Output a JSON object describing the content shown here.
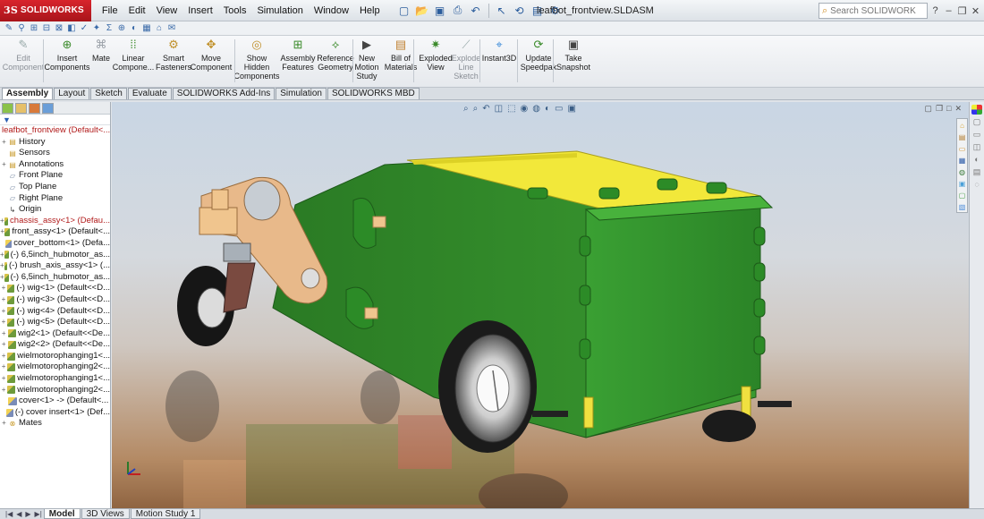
{
  "app": {
    "brand": "SOLIDWORKS",
    "document_title": "leafbot_frontview.SLDASM"
  },
  "menu": [
    "File",
    "Edit",
    "View",
    "Insert",
    "Tools",
    "Simulation",
    "Window",
    "Help"
  ],
  "search": {
    "placeholder": "Search SOLIDWORKS Help"
  },
  "commands": [
    {
      "label": "Edit Component",
      "icon": "edit-component-icon",
      "enabled": false
    },
    {
      "label": "Insert Components",
      "icon": "insert-components-icon",
      "enabled": true
    },
    {
      "label": "Mate",
      "icon": "mate-icon",
      "enabled": true
    },
    {
      "label": "Linear Compone...",
      "icon": "linear-pattern-icon",
      "enabled": true
    },
    {
      "label": "Smart Fasteners",
      "icon": "smart-fasteners-icon",
      "enabled": true
    },
    {
      "label": "Move Component",
      "icon": "move-component-icon",
      "enabled": true
    },
    {
      "label": "Show Hidden Components",
      "icon": "show-hidden-icon",
      "enabled": true
    },
    {
      "label": "Assembly Features",
      "icon": "assembly-features-icon",
      "enabled": true
    },
    {
      "label": "Reference Geometry",
      "icon": "reference-geometry-icon",
      "enabled": true
    },
    {
      "label": "New Motion Study",
      "icon": "motion-study-icon",
      "enabled": true
    },
    {
      "label": "Bill of Materials",
      "icon": "bom-icon",
      "enabled": true
    },
    {
      "label": "Exploded View",
      "icon": "exploded-view-icon",
      "enabled": true
    },
    {
      "label": "Explode Line Sketch",
      "icon": "explode-line-icon",
      "enabled": false
    },
    {
      "label": "Instant3D",
      "icon": "instant3d-icon",
      "enabled": true
    },
    {
      "label": "Update Speedpak",
      "icon": "speedpak-icon",
      "enabled": true
    },
    {
      "label": "Take Snapshot",
      "icon": "snapshot-icon",
      "enabled": true
    }
  ],
  "tabs": [
    "Assembly",
    "Layout",
    "Sketch",
    "Evaluate",
    "SOLIDWORKS Add-Ins",
    "Simulation",
    "SOLIDWORKS MBD"
  ],
  "active_tab": "Assembly",
  "tree": {
    "filter_icon": "filter-icon",
    "items": [
      {
        "label": "leafbot_frontview  (Default<...",
        "icon": "assembly",
        "red": true,
        "expand": ""
      },
      {
        "label": "History",
        "icon": "folder",
        "expand": "+"
      },
      {
        "label": "Sensors",
        "icon": "folder",
        "expand": ""
      },
      {
        "label": "Annotations",
        "icon": "folder",
        "expand": "+"
      },
      {
        "label": "Front Plane",
        "icon": "plane",
        "expand": ""
      },
      {
        "label": "Top Plane",
        "icon": "plane",
        "expand": ""
      },
      {
        "label": "Right Plane",
        "icon": "plane",
        "expand": ""
      },
      {
        "label": "Origin",
        "icon": "origin",
        "expand": ""
      },
      {
        "label": "chassis_assy<1> (Defau...",
        "icon": "assembly",
        "red": true,
        "expand": "+"
      },
      {
        "label": "front_assy<1> (Default<...",
        "icon": "assembly",
        "expand": "+"
      },
      {
        "label": "cover_bottom<1> (Defa...",
        "icon": "part",
        "expand": ""
      },
      {
        "label": "(-) 6,5inch_hubmotor_as...",
        "icon": "assembly",
        "expand": "+"
      },
      {
        "label": "(-) brush_axis_assy<1> (...",
        "icon": "assembly",
        "expand": "+"
      },
      {
        "label": "(-) 6,5inch_hubmotor_as...",
        "icon": "assembly",
        "expand": "+"
      },
      {
        "label": "(-) wig<1> (Default<<D...",
        "icon": "assembly",
        "expand": "+"
      },
      {
        "label": "(-) wig<3> (Default<<D...",
        "icon": "assembly",
        "expand": "+"
      },
      {
        "label": "(-) wig<4> (Default<<D...",
        "icon": "assembly",
        "expand": "+"
      },
      {
        "label": "(-) wig<5> (Default<<D...",
        "icon": "assembly",
        "expand": "+"
      },
      {
        "label": "wig2<1> (Default<<De...",
        "icon": "assembly",
        "expand": "+"
      },
      {
        "label": "wig2<2> (Default<<De...",
        "icon": "assembly",
        "expand": "+"
      },
      {
        "label": "wielmotorophanging1<...",
        "icon": "assembly",
        "expand": "+"
      },
      {
        "label": "wielmotorophanging2<...",
        "icon": "assembly",
        "expand": "+"
      },
      {
        "label": "wielmotorophanging1<...",
        "icon": "assembly",
        "expand": "+"
      },
      {
        "label": "wielmotorophanging2<...",
        "icon": "assembly",
        "expand": "+"
      },
      {
        "label": "cover<1> -> (Default<...",
        "icon": "part",
        "expand": ""
      },
      {
        "label": "(-) cover insert<1> (Def...",
        "icon": "part",
        "expand": ""
      },
      {
        "label": "Mates",
        "icon": "mates",
        "expand": "+"
      }
    ]
  },
  "viewport": {
    "model_name": "leafbot robot chassis",
    "body_color": "#2f8a2a",
    "cover_color": "#f2e83a",
    "bracket_color": "#e8b98a"
  },
  "bottom_tabs": [
    "Model",
    "3D Views",
    "Motion Study 1"
  ],
  "active_bottom_tab": "Model"
}
